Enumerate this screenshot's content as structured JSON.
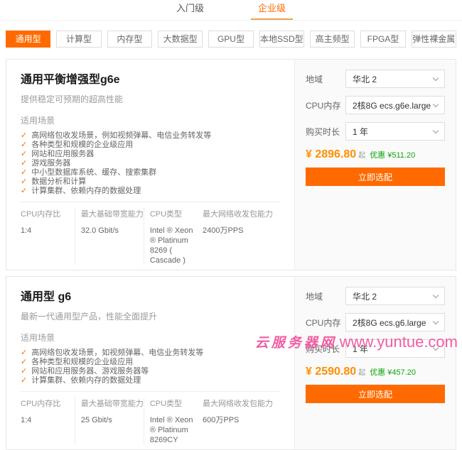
{
  "colors": {
    "accent": "#ff6a00",
    "underline": "#f0a14b",
    "price": "#ff8f00",
    "discount": "#09a709",
    "watermark": "#f25ca2"
  },
  "icons": {
    "check": "✓",
    "chevron_down": "chevron-down"
  },
  "tabs": [
    {
      "label": "入门级",
      "active": false
    },
    {
      "label": "企业级",
      "active": true
    }
  ],
  "categories": [
    {
      "label": "通用型",
      "active": true
    },
    {
      "label": "计算型",
      "active": false
    },
    {
      "label": "内存型",
      "active": false
    },
    {
      "label": "大数据型",
      "active": false
    },
    {
      "label": "GPU型",
      "active": false
    },
    {
      "label": "本地SSD型",
      "active": false
    },
    {
      "label": "高主频型",
      "active": false
    },
    {
      "label": "FPGA型",
      "active": false
    },
    {
      "label": "弹性裸金属",
      "active": false
    }
  ],
  "cards": [
    {
      "title": "通用平衡增强型g6e",
      "description": "提供稳定可预期的超高性能",
      "scenarios_label": "适用场景",
      "scenarios": [
        "高网络包收发场景，例如视频弹幕、电信业务转发等",
        "各种类型和规模的企业级应用",
        "网站和应用服务器",
        "游戏服务器",
        "中小型数据库系统、缓存、搜索集群",
        "数据分析和计算",
        "计算集群、依赖内存的数据处理"
      ],
      "specs": [
        {
          "label": "CPU内存比",
          "value": "1:4"
        },
        {
          "label": "最大基础带宽能力",
          "value": "32.0 Gbit/s"
        },
        {
          "label": "CPU类型",
          "value": "Intel ® Xeon ® Platinum 8269 ( Cascade )"
        },
        {
          "label": "最大网络收发包能力",
          "value": "2400万PPS"
        }
      ],
      "config": {
        "region_label": "地域",
        "region_value": "华北 2",
        "cpu_label": "CPU内存",
        "cpu_value": "2核8G ecs.g6e.large",
        "duration_label": "购买时长",
        "duration_value": "1 年"
      },
      "price": {
        "amount": "¥ 2896.80",
        "suffix": "起",
        "discount": "优惠 ¥511.20"
      },
      "cta": "立即选配"
    },
    {
      "title": "通用型 g6",
      "description": "最新一代通用型产品，性能全面提升",
      "scenarios_label": "适用场景",
      "scenarios": [
        "高网络包收发场景，如视频弹幕、电信业务转发等",
        "各种类型和规模的企业级应用",
        "网站和应用服务器、游戏服务器等",
        "计算集群、依赖内存的数据处理"
      ],
      "specs": [
        {
          "label": "CPU内存比",
          "value": "1:4"
        },
        {
          "label": "最大基础带宽能力",
          "value": "25 Gbit/s"
        },
        {
          "label": "CPU类型",
          "value": "Intel ® Xeon ® Platinum 8269CY"
        },
        {
          "label": "最大网络收发包能力",
          "value": "600万PPS"
        }
      ],
      "config": {
        "region_label": "地域",
        "region_value": "华北 2",
        "cpu_label": "CPU内存",
        "cpu_value": "2核8G ecs.g6.large",
        "duration_label": "购买时长",
        "duration_value": "1 年"
      },
      "price": {
        "amount": "¥ 2590.80",
        "suffix": "起",
        "discount": "优惠 ¥457.20"
      },
      "cta": "立即选配"
    }
  ],
  "watermark": {
    "site_name": "云服务器网",
    "site_url": "www.yuntue.com"
  }
}
